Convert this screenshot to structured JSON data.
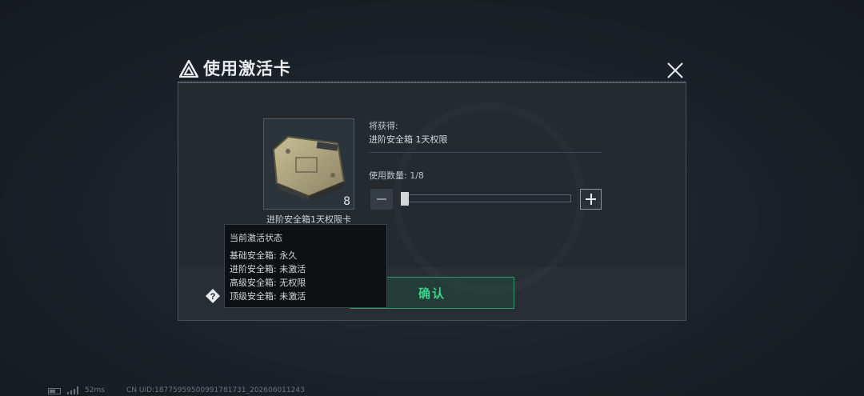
{
  "dialog": {
    "title": "使用激活卡",
    "item": {
      "name": "进阶安全箱1天权限卡",
      "count": "8"
    },
    "will_obtain_label": "将获得:",
    "will_obtain_value": "进阶安全箱 1天权限",
    "quantity_label": "使用数量: 1/8",
    "quantity": {
      "current": 1,
      "max": 8
    },
    "confirm_label": "确认"
  },
  "tooltip": {
    "title": "当前激活状态",
    "rows": [
      "基础安全箱: 永久",
      "进阶安全箱: 未激活",
      "高级安全箱: 无权限",
      "顶级安全箱: 未激活"
    ]
  },
  "status_bar": {
    "ping": "52ms",
    "uid": "CN UID:18775959500991781731_202606011243"
  },
  "colors": {
    "accent_green": "#3bd28a",
    "dialog_bg": "#232a30"
  },
  "icons": [
    "title-logo-icon",
    "close-icon",
    "minus-icon",
    "plus-icon",
    "help-icon",
    "battery-icon",
    "signal-icon"
  ]
}
